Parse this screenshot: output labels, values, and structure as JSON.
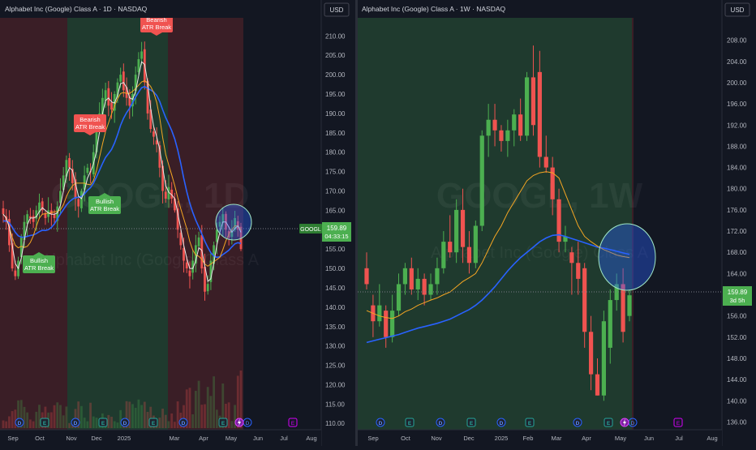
{
  "colors": {
    "background": "#131722",
    "up_candle": "#4caf50",
    "down_candle": "#ef5350",
    "bull_zone": "#1f3a2e",
    "bear_zone": "#3a1e26",
    "ma_blue": "#2962ff",
    "ma_orange": "#f5a623",
    "ma_white": "#e8e8e8",
    "axis_text": "#b2b5be",
    "circle_fill": "#2962ff"
  },
  "panels": [
    {
      "id": "daily",
      "title": "Alphabet Inc (Google) Class A · 1D · NASDAQ",
      "watermark_ticker": "GOOGL, 1D",
      "watermark_name": "Alphabet Inc (Google) Class A",
      "currency_button": "USD",
      "price_tag": "159.89",
      "countdown": "04:33:15",
      "symbol_tag": "GOOGL",
      "annotations": [
        {
          "text": [
            "Bearish",
            "ATR Break"
          ],
          "kind": "bear"
        },
        {
          "text": [
            "Bearish",
            "ATR Break"
          ],
          "kind": "bear"
        },
        {
          "text": [
            "Bullish",
            "ATR Break"
          ],
          "kind": "bull"
        },
        {
          "text": [
            "Bullish",
            "ATR Break"
          ],
          "kind": "bull"
        }
      ],
      "event_markers": [
        "D",
        "E",
        "D",
        "E",
        "D",
        "E",
        "D",
        "E"
      ]
    },
    {
      "id": "weekly",
      "title": "Alphabet Inc (Google) Class A · 1W · NASDAQ",
      "watermark_ticker": "GOOGL, 1W",
      "watermark_name": "Alphabet Inc (Google) Class A",
      "currency_button": "USD",
      "price_tag": "159.89",
      "countdown": "3d 5h",
      "event_markers": [
        "D",
        "E",
        "D",
        "E",
        "D",
        "E",
        "D",
        "E"
      ]
    }
  ],
  "chart_data": [
    {
      "type": "candlestick",
      "title": "Alphabet Inc (Google) Class A · 1D · NASDAQ",
      "timeframe": "1D",
      "x_tick_labels": [
        "Sep",
        "Oct",
        "Nov",
        "Dec",
        "2025",
        "Mar",
        "Apr",
        "May",
        "Jun",
        "Jul",
        "Aug"
      ],
      "y_tick_labels": [
        "110.00",
        "115.00",
        "120.00",
        "125.00",
        "130.00",
        "135.00",
        "140.00",
        "145.00",
        "150.00",
        "155.00",
        "160.00",
        "165.00",
        "170.00",
        "175.00",
        "180.00",
        "185.00",
        "190.00",
        "195.00",
        "200.00",
        "205.00",
        "210.00"
      ],
      "ylim": [
        109,
        213
      ],
      "last_price": 159.89,
      "closes_approx": [
        164,
        162,
        156,
        150,
        148,
        152,
        158,
        162,
        164,
        163,
        162,
        165,
        167,
        165,
        163,
        165,
        164,
        163,
        166,
        170,
        174,
        178,
        176,
        172,
        168,
        166,
        170,
        174,
        176,
        175,
        180,
        186,
        190,
        194,
        196,
        192,
        191,
        195,
        198,
        200,
        196,
        194,
        192,
        195,
        200,
        204,
        206,
        198,
        190,
        186,
        184,
        182,
        176,
        170,
        168,
        171,
        168,
        165,
        160,
        156,
        152,
        150,
        148,
        152,
        156,
        158,
        150,
        144,
        146,
        152,
        156,
        160,
        162,
        164,
        160,
        158,
        160,
        163,
        160,
        155
      ],
      "zones": [
        {
          "kind": "bear",
          "from_label": "Aug",
          "to_label": "Sep/Oct"
        },
        {
          "kind": "bull",
          "from_label": "Oct",
          "to_label": "Jan"
        },
        {
          "kind": "bear",
          "from_label": "Feb",
          "to_label": "May"
        }
      ],
      "moving_averages": [
        {
          "color": "white"
        },
        {
          "color": "orange"
        },
        {
          "color": "blue"
        }
      ],
      "volume": true,
      "grid": false
    },
    {
      "type": "candlestick",
      "title": "Alphabet Inc (Google) Class A · 1W · NASDAQ",
      "timeframe": "1W",
      "x_tick_labels": [
        "Sep",
        "Oct",
        "Nov",
        "Dec",
        "2025",
        "Feb",
        "Mar",
        "Apr",
        "May",
        "Jun",
        "Jul",
        "Aug"
      ],
      "y_tick_labels": [
        "136.00",
        "140.00",
        "144.00",
        "148.00",
        "152.00",
        "156.00",
        "160.00",
        "164.00",
        "168.00",
        "172.00",
        "176.00",
        "180.00",
        "184.00",
        "188.00",
        "192.00",
        "196.00",
        "200.00",
        "204.00",
        "208.00"
      ],
      "ylim": [
        135,
        211
      ],
      "last_price": 159.89,
      "candles": [
        {
          "o": 165.0,
          "h": 168.0,
          "l": 161.0,
          "c": 162.0
        },
        {
          "o": 158.0,
          "h": 160.0,
          "l": 152.0,
          "c": 155.0
        },
        {
          "o": 155.0,
          "h": 162.0,
          "l": 154.0,
          "c": 158.0
        },
        {
          "o": 157.0,
          "h": 158.0,
          "l": 150.0,
          "c": 152.0
        },
        {
          "o": 152.0,
          "h": 160.0,
          "l": 151.0,
          "c": 157.0
        },
        {
          "o": 157.0,
          "h": 164.0,
          "l": 156.0,
          "c": 162.0
        },
        {
          "o": 162.0,
          "h": 166.0,
          "l": 160.0,
          "c": 165.0
        },
        {
          "o": 165.0,
          "h": 167.0,
          "l": 160.0,
          "c": 161.0
        },
        {
          "o": 161.0,
          "h": 165.0,
          "l": 159.0,
          "c": 163.0
        },
        {
          "o": 163.0,
          "h": 164.0,
          "l": 158.0,
          "c": 160.0
        },
        {
          "o": 160.0,
          "h": 164.0,
          "l": 159.0,
          "c": 162.0
        },
        {
          "o": 162.0,
          "h": 167.0,
          "l": 160.0,
          "c": 165.0
        },
        {
          "o": 165.0,
          "h": 172.0,
          "l": 164.0,
          "c": 170.0
        },
        {
          "o": 170.0,
          "h": 175.0,
          "l": 167.0,
          "c": 168.0
        },
        {
          "o": 168.0,
          "h": 178.0,
          "l": 166.0,
          "c": 176.0
        },
        {
          "o": 176.0,
          "h": 180.0,
          "l": 166.0,
          "c": 169.0
        },
        {
          "o": 169.0,
          "h": 172.0,
          "l": 164.0,
          "c": 166.0
        },
        {
          "o": 166.0,
          "h": 174.0,
          "l": 165.0,
          "c": 173.0
        },
        {
          "o": 173.0,
          "h": 191.0,
          "l": 172.0,
          "c": 190.0
        },
        {
          "o": 190.0,
          "h": 196.0,
          "l": 186.0,
          "c": 193.0
        },
        {
          "o": 193.0,
          "h": 196.0,
          "l": 188.0,
          "c": 191.0
        },
        {
          "o": 191.0,
          "h": 192.0,
          "l": 187.0,
          "c": 189.0
        },
        {
          "o": 189.0,
          "h": 193.0,
          "l": 186.0,
          "c": 191.0
        },
        {
          "o": 191.0,
          "h": 195.0,
          "l": 188.0,
          "c": 194.0
        },
        {
          "o": 194.0,
          "h": 197.0,
          "l": 189.0,
          "c": 190.0
        },
        {
          "o": 190.0,
          "h": 202.0,
          "l": 189.0,
          "c": 201.0
        },
        {
          "o": 201.0,
          "h": 207.0,
          "l": 190.0,
          "c": 192.0
        },
        {
          "o": 202.0,
          "h": 206.0,
          "l": 184.0,
          "c": 186.0
        },
        {
          "o": 186.0,
          "h": 190.0,
          "l": 183.0,
          "c": 184.0
        },
        {
          "o": 184.0,
          "h": 186.0,
          "l": 175.0,
          "c": 178.0
        },
        {
          "o": 178.0,
          "h": 180.0,
          "l": 168.0,
          "c": 170.0
        },
        {
          "o": 170.0,
          "h": 173.0,
          "l": 168.0,
          "c": 171.0
        },
        {
          "o": 168.0,
          "h": 169.0,
          "l": 160.0,
          "c": 166.0
        },
        {
          "o": 166.0,
          "h": 170.0,
          "l": 160.0,
          "c": 163.0
        },
        {
          "o": 165.0,
          "h": 166.0,
          "l": 150.0,
          "c": 153.0
        },
        {
          "o": 153.0,
          "h": 156.0,
          "l": 142.0,
          "c": 145.0
        },
        {
          "o": 145.0,
          "h": 148.0,
          "l": 141.0,
          "c": 141.0
        },
        {
          "o": 141.0,
          "h": 157.0,
          "l": 140.0,
          "c": 155.0
        },
        {
          "o": 150.0,
          "h": 161.0,
          "l": 147.0,
          "c": 159.0
        },
        {
          "o": 159.0,
          "h": 164.0,
          "l": 157.0,
          "c": 162.0
        },
        {
          "o": 162.0,
          "h": 165.0,
          "l": 151.0,
          "c": 153.0
        },
        {
          "o": 156.0,
          "h": 161.0,
          "l": 155.0,
          "c": 159.9
        }
      ],
      "ma_orange": [
        157.0,
        156.5,
        156.0,
        155.7,
        155.5,
        156.0,
        156.8,
        157.3,
        158.0,
        158.5,
        159.0,
        159.4,
        160.0,
        160.5,
        161.5,
        162.5,
        163.2,
        164.0,
        166.0,
        168.5,
        171.0,
        173.0,
        175.5,
        177.5,
        179.5,
        181.5,
        182.5,
        183.0,
        183.2,
        183.0,
        182.0,
        179.0,
        176.0,
        173.0,
        171.0,
        170.0,
        169.2,
        168.5,
        168.0,
        167.5,
        167.2,
        167.0
      ],
      "ma_blue": [
        151.0,
        151.3,
        151.6,
        151.9,
        152.2,
        152.5,
        152.9,
        153.3,
        153.7,
        154.0,
        154.3,
        154.6,
        155.0,
        155.4,
        156.0,
        156.6,
        157.2,
        158.0,
        159.0,
        160.2,
        161.5,
        163.0,
        164.5,
        165.8,
        167.0,
        168.0,
        169.0,
        170.0,
        170.7,
        171.2,
        171.3,
        171.0,
        170.6,
        170.2,
        169.8,
        169.4,
        169.0,
        168.8,
        168.5,
        168.2,
        167.9,
        167.6
      ],
      "zones": [
        {
          "kind": "bull",
          "from_label": "Sep",
          "to_label": "Apr"
        },
        {
          "kind": "bear",
          "from_label": "Apr",
          "to_label": "May"
        }
      ],
      "grid": false
    }
  ]
}
